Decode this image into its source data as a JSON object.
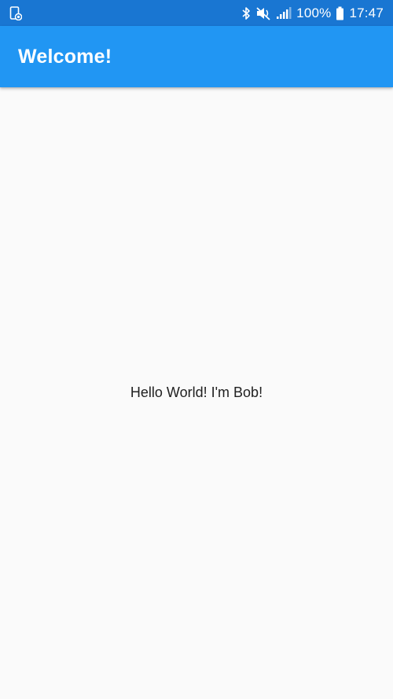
{
  "status_bar": {
    "left_icon": "screen-record-icon",
    "icons": [
      "bluetooth-icon",
      "mute-icon",
      "signal-icon",
      "battery-icon"
    ],
    "battery_percent": "100%",
    "time": "17:47",
    "background": "#1976d2"
  },
  "app_bar": {
    "title": "Welcome!",
    "background": "#2196f3"
  },
  "body": {
    "message": "Hello World! I'm Bob!",
    "background": "#fafafa"
  }
}
